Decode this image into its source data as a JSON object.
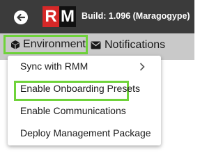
{
  "header": {
    "back_icon": "arrow-left-circle-icon",
    "logo": {
      "letter_r": "R",
      "letter_m": "M"
    },
    "build_text": "Build: 1.096 (Maragogype)"
  },
  "menubar": {
    "environment": {
      "icon": "cube-icon",
      "label": "Environment"
    },
    "notifications": {
      "icon": "envelope-icon",
      "label": "Notifications"
    }
  },
  "dropdown": {
    "items": [
      {
        "label": "Sync with RMM",
        "has_submenu": true
      },
      {
        "label": "Enable Onboarding Presets"
      },
      {
        "label": "Enable Communications"
      },
      {
        "label": "Deploy Management Package"
      }
    ]
  },
  "colors": {
    "topbar": "#3b3b3b",
    "menubar": "#c9c9c9",
    "highlight": "#6fd33a",
    "logo_red": "#d62828"
  }
}
